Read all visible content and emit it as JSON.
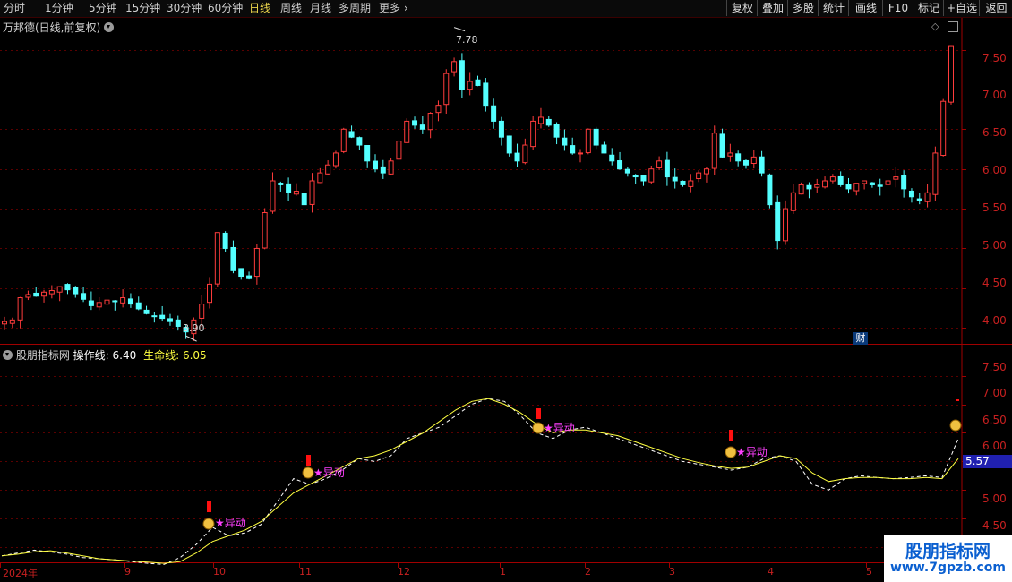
{
  "toolbar": {
    "periods": [
      "分时",
      "1分钟",
      "5分钟",
      "15分钟",
      "30分钟",
      "60分钟",
      "日线",
      "周线",
      "月线",
      "多周期",
      "更多"
    ],
    "active_period": "日线",
    "right_buttons": [
      "复权",
      "叠加",
      "多股",
      "统计",
      "画线",
      "F10",
      "标记",
      "+自选",
      "返回"
    ]
  },
  "price_panel": {
    "stock_title": "万邦德(日线,前复权)",
    "high_marker": "7.78",
    "low_marker": "3.90",
    "finance_badge": "财",
    "y_ticks": [
      "7.50",
      "7.00",
      "6.50",
      "6.00",
      "5.50",
      "5.00",
      "4.50",
      "4.00"
    ]
  },
  "indicator_panel": {
    "name": "股朋指标网",
    "op_line_label": "操作线:",
    "op_line_value": "6.40",
    "life_line_label": "生命线:",
    "life_line_value": "6.05",
    "signal_label": "★异动",
    "current_value": "5.57",
    "y_ticks": [
      "7.50",
      "7.00",
      "6.50",
      "6.00",
      "5.50",
      "5.00",
      "4.50"
    ]
  },
  "date_axis": {
    "labels": [
      "2024年",
      "9",
      "10",
      "11",
      "12",
      "1",
      "2",
      "3",
      "4",
      "5"
    ]
  },
  "watermark": {
    "title": "股朋指标网",
    "url": "www.7gpzb.com"
  },
  "colors": {
    "up": "#ff3c3c",
    "down": "#54ffff",
    "grid": "#5a0000",
    "op_line": "#ffffff",
    "life_line": "#ffff40",
    "signal_text": "#ff40ff"
  },
  "chart_data": [
    {
      "type": "candlestick",
      "title": "万邦德(日线,前复权)",
      "ylim": [
        3.8,
        7.9
      ],
      "price_path": [
        4.08,
        4.1,
        4.38,
        4.42,
        4.4,
        4.45,
        4.47,
        4.52,
        4.48,
        4.43,
        4.36,
        4.28,
        4.32,
        4.35,
        4.33,
        4.38,
        4.3,
        4.24,
        4.18,
        4.15,
        4.12,
        4.08,
        4.02,
        3.95,
        4.1,
        4.3,
        4.55,
        5.2,
        5.0,
        4.72,
        4.65,
        4.62,
        5.0,
        5.45,
        5.85,
        5.8,
        5.7,
        5.72,
        5.55,
        5.85,
        5.95,
        6.05,
        6.2,
        6.5,
        6.4,
        6.3,
        6.1,
        6.0,
        5.95,
        6.1,
        6.35,
        6.6,
        6.55,
        6.5,
        6.7,
        6.8,
        7.2,
        7.35,
        7.0,
        7.1,
        7.05,
        6.8,
        6.6,
        6.4,
        6.2,
        6.1,
        6.3,
        6.6,
        6.65,
        6.55,
        6.4,
        6.3,
        6.2,
        6.2,
        6.5,
        6.3,
        6.2,
        6.1,
        6.0,
        5.95,
        5.9,
        5.85,
        6.0,
        6.1,
        5.9,
        5.85,
        5.8,
        5.85,
        5.95,
        6.0,
        6.45,
        6.15,
        6.2,
        6.1,
        6.05,
        6.15,
        5.95,
        5.55,
        5.1,
        5.5,
        5.7,
        5.8,
        5.75,
        5.8,
        5.85,
        5.9,
        5.8,
        5.75,
        5.82,
        5.85,
        5.8,
        5.78,
        5.85,
        5.9,
        5.75,
        5.65,
        5.6,
        5.7,
        6.2,
        6.85,
        7.55
      ],
      "high": 7.78,
      "low": 3.9
    },
    {
      "type": "line",
      "title": "股朋指标网",
      "ylim": [
        4.3,
        7.9
      ],
      "series": [
        {
          "name": "操作线",
          "values": [
            4.35,
            4.4,
            4.45,
            4.42,
            4.38,
            4.32,
            4.3,
            4.28,
            4.25,
            4.22,
            4.2,
            4.32,
            4.55,
            4.85,
            4.7,
            4.75,
            4.9,
            5.3,
            5.7,
            5.6,
            5.7,
            5.85,
            6.05,
            6.0,
            6.1,
            6.4,
            6.5,
            6.6,
            6.8,
            7.0,
            7.1,
            7.05,
            6.8,
            6.5,
            6.4,
            6.55,
            6.6,
            6.5,
            6.4,
            6.3,
            6.2,
            6.1,
            6.0,
            5.95,
            5.9,
            5.85,
            5.9,
            6.05,
            6.1,
            6.0,
            5.6,
            5.5,
            5.7,
            5.75,
            5.72,
            5.7,
            5.72,
            5.75,
            5.72,
            6.4
          ]
        },
        {
          "name": "生命线",
          "values": [
            4.35,
            4.38,
            4.42,
            4.44,
            4.4,
            4.35,
            4.3,
            4.28,
            4.26,
            4.24,
            4.22,
            4.25,
            4.4,
            4.6,
            4.7,
            4.8,
            4.95,
            5.2,
            5.45,
            5.6,
            5.75,
            5.9,
            6.05,
            6.1,
            6.2,
            6.35,
            6.5,
            6.7,
            6.9,
            7.05,
            7.1,
            7.0,
            6.85,
            6.65,
            6.5,
            6.55,
            6.55,
            6.5,
            6.45,
            6.35,
            6.25,
            6.15,
            6.05,
            5.98,
            5.92,
            5.88,
            5.9,
            6.0,
            6.1,
            6.05,
            5.8,
            5.65,
            5.7,
            5.72,
            5.72,
            5.7,
            5.7,
            5.72,
            5.7,
            6.05
          ]
        }
      ]
    }
  ]
}
